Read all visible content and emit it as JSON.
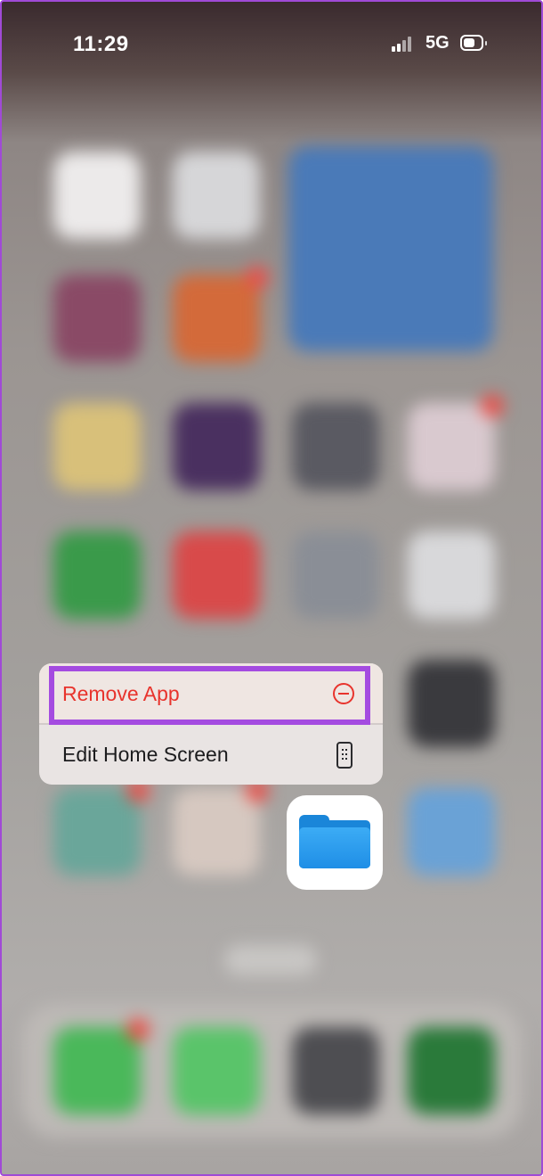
{
  "status_bar": {
    "time": "11:29",
    "network": "5G",
    "signal_icon": "cellular-signal-icon",
    "battery_icon": "battery-icon"
  },
  "context_menu": {
    "remove_app_label": "Remove App",
    "remove_app_icon": "minus-circle-icon",
    "remove_app_color": "#e8342d",
    "edit_home_screen_label": "Edit Home Screen",
    "edit_home_screen_icon": "phone-screen-icon"
  },
  "highlight_color": "#a44be0",
  "focused_app": {
    "icon": "files-folder-icon",
    "accent": "#1f8ee6"
  }
}
